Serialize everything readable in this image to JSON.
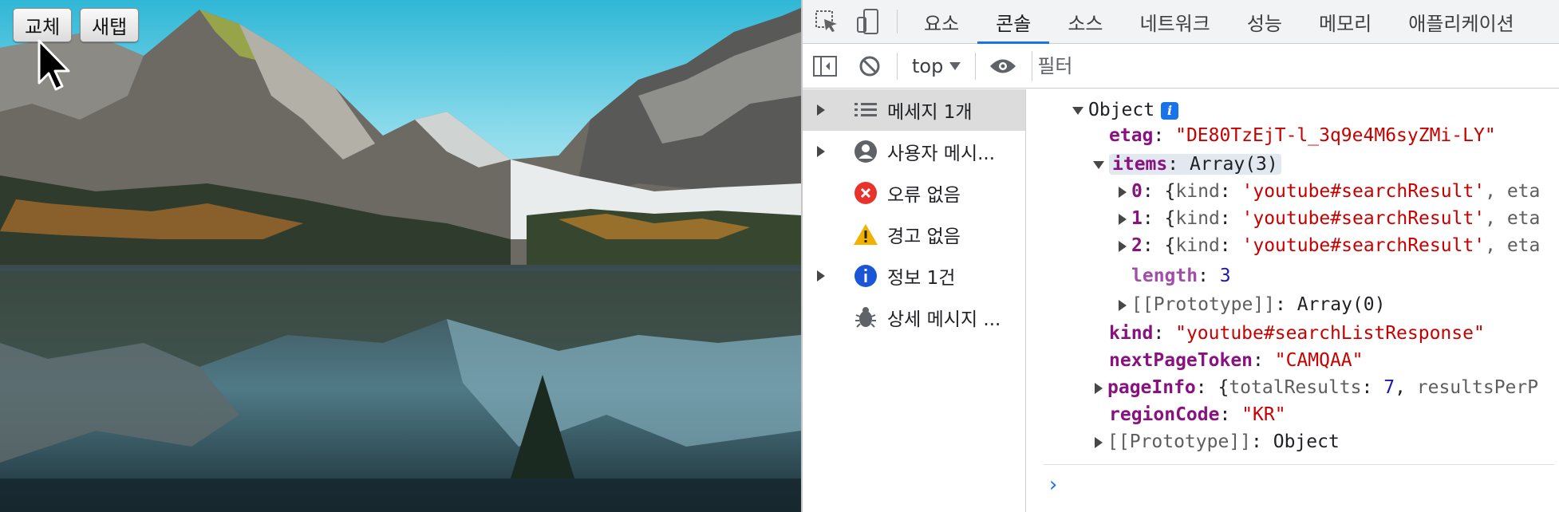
{
  "page": {
    "buttons": {
      "replace": "교체",
      "new_tab": "새탭"
    }
  },
  "devtools": {
    "tabs": [
      "요소",
      "콘솔",
      "소스",
      "네트워크",
      "성능",
      "메모리",
      "애플리케이션"
    ],
    "active_tab": "콘솔",
    "toolbar": {
      "context": "top",
      "filter_placeholder": "필터"
    },
    "sidebar": [
      {
        "label": "메세지 1개",
        "icon": "list-icon",
        "expandable": true,
        "selected": true
      },
      {
        "label": "사용자 메시...",
        "icon": "user-icon",
        "expandable": true,
        "selected": false
      },
      {
        "label": "오류 없음",
        "icon": "error-icon",
        "expandable": false,
        "selected": false
      },
      {
        "label": "경고 없음",
        "icon": "warning-icon",
        "expandable": false,
        "selected": false
      },
      {
        "label": "정보 1건",
        "icon": "info-icon",
        "expandable": true,
        "selected": false
      },
      {
        "label": "상세 메시지 ...",
        "icon": "bug-icon",
        "expandable": false,
        "selected": false
      }
    ],
    "console": {
      "root_label": "Object",
      "etag_key": "etag",
      "etag_value": "\"DE80TzEjT-l_3q9e4M6syZMi-LY\"",
      "items_key": "items",
      "items_value": "Array(3)",
      "item_rows": [
        {
          "index": "0",
          "kind_key": "kind",
          "kind_value": "'youtube#searchResult'",
          "rest": ", eta"
        },
        {
          "index": "1",
          "kind_key": "kind",
          "kind_value": "'youtube#searchResult'",
          "rest": ", eta"
        },
        {
          "index": "2",
          "kind_key": "kind",
          "kind_value": "'youtube#searchResult'",
          "rest": ", eta"
        }
      ],
      "length_key": "length",
      "length_value": "3",
      "items_proto": "[[Prototype]]",
      "items_proto_value": "Array(0)",
      "kind_key": "kind",
      "kind_value": "\"youtube#searchListResponse\"",
      "token_key": "nextPageToken",
      "token_value": "\"CAMQAA\"",
      "pageinfo_key": "pageInfo",
      "pageinfo_inner_key": "totalResults",
      "pageinfo_total": "7",
      "pageinfo_rest": "resultsPerP",
      "region_key": "regionCode",
      "region_value": "\"KR\"",
      "proto_key": "[[Prototype]]",
      "proto_value": "Object"
    }
  },
  "colors": {
    "accent": "#1a73e8",
    "key": "#881280",
    "string": "#c80000",
    "number": "#1a1aa6"
  }
}
